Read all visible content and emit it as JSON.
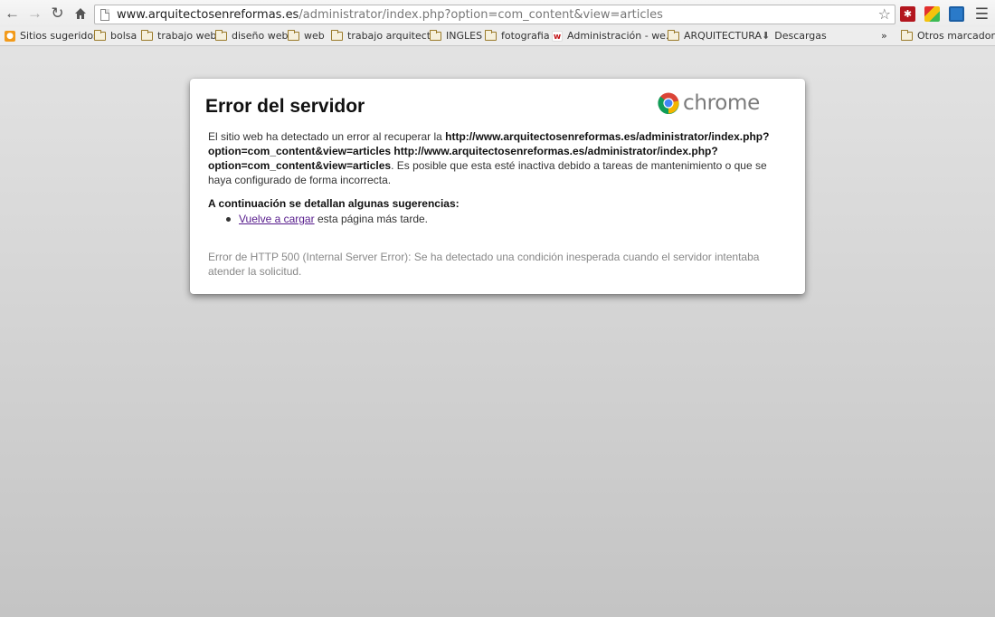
{
  "browser": {
    "url_domain": "www.arquitectosenreformas.es",
    "url_path": "/administrator/index.php?option=com_content&view=articles"
  },
  "bookmarks": [
    {
      "label": "Sitios sugeridos",
      "icon": "suggested-sites-icon"
    },
    {
      "label": "bolsa",
      "icon": "folder-icon"
    },
    {
      "label": "trabajo web",
      "icon": "folder-icon"
    },
    {
      "label": "diseño web",
      "icon": "folder-icon"
    },
    {
      "label": "web",
      "icon": "folder-icon"
    },
    {
      "label": "trabajo arquitecto",
      "icon": "folder-icon"
    },
    {
      "label": "INGLES",
      "icon": "folder-icon"
    },
    {
      "label": "fotografia",
      "icon": "folder-icon"
    },
    {
      "label": "Administración - we...",
      "icon": "site-favicon"
    },
    {
      "label": "ARQUITECTURA",
      "icon": "folder-icon"
    },
    {
      "label": "Descargas",
      "icon": "download-icon"
    },
    {
      "label": "»",
      "icon": "overflow-chevron-icon"
    },
    {
      "label": "Otros marcadores",
      "icon": "folder-icon"
    }
  ],
  "error_page": {
    "title": "Error del servidor",
    "brand": "chrome",
    "intro_1": "El sitio web ha detectado un error al recuperar la ",
    "url_1": "http://www.arquitectosenreformas.es/administrator/index.php?option=com_content&view=articles",
    "url_2": "http://www.arquitectosenreformas.es/administrator/index.php?option=com_content&view=articles",
    "intro_2": ". Es posible que esta esté inactiva debido a tareas de mantenimiento o que se haya configurado de forma incorrecta.",
    "suggestions_heading": "A continuación se detallan algunas sugerencias:",
    "reload_link": "Vuelve a cargar",
    "reload_suffix": " esta página más tarde.",
    "http_error": "Error de HTTP 500 (Internal Server Error): Se ha detectado una condición inesperada cuando el servidor intentaba atender la solicitud."
  },
  "colors": {
    "link_visited": "#551a8b",
    "background": "#c4c4c4"
  }
}
